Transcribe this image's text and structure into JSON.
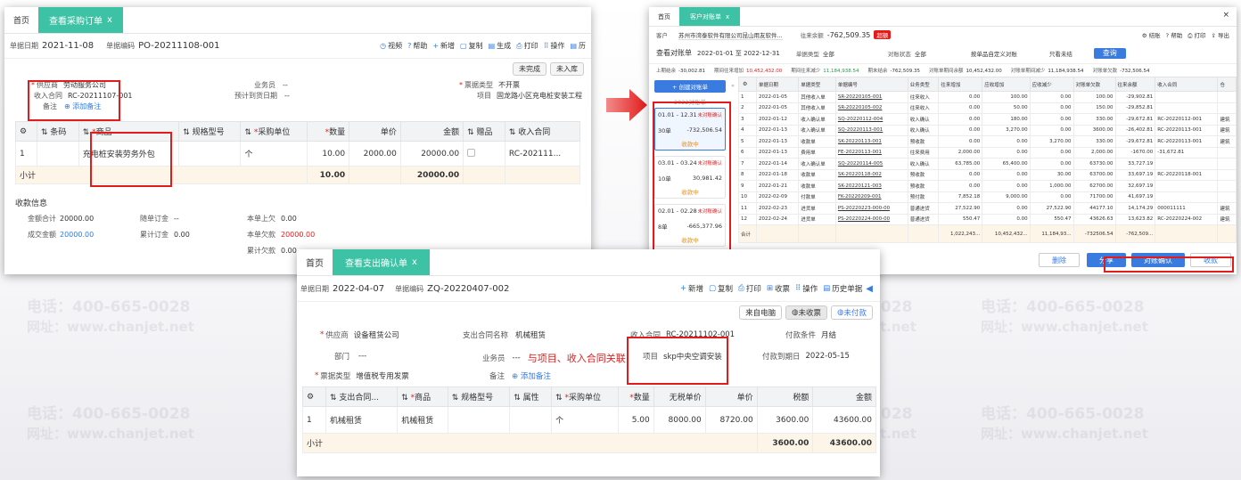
{
  "watermark": {
    "phone": "电话：400-665-0028",
    "site": "网址：www.chanjet.net"
  },
  "win1": {
    "home": "首页",
    "tab": "查看采购订单",
    "close": "x",
    "date_label": "单据日期",
    "date": "2021-11-08",
    "no_label": "单据编码",
    "no": "PO-20211108-001",
    "toolbar": [
      {
        "icon": "◷",
        "label": "视频"
      },
      {
        "icon": "?",
        "label": "帮助"
      },
      {
        "icon": "+",
        "label": "新增"
      },
      {
        "icon": "▢",
        "label": "复制"
      },
      {
        "icon": "▤",
        "label": "生成"
      },
      {
        "icon": "⎙",
        "label": "打印"
      },
      {
        "icon": "⠿",
        "label": "操作"
      },
      {
        "icon": "▤",
        "label": "历"
      }
    ],
    "status": [
      "未完成",
      "未入库"
    ],
    "supplier_label": "供应商",
    "supplier": "劳动服务公司",
    "contract_label": "收入合同",
    "contract": "RC-20211107-001",
    "remark_label": "备注",
    "add_remark": "添加备注",
    "staff_label": "业务员",
    "staff": "--",
    "arrival_label": "预计到货日期",
    "arrival": "--",
    "invoice_label": "票据类型",
    "invoice": "不开票",
    "project_label": "项目",
    "project": "固龙路小区充电桩安装工程",
    "headers": [
      "条码",
      "商品",
      "规格型号",
      "采购单位",
      "数量",
      "单价",
      "金额",
      "赠品",
      "收入合同"
    ],
    "row": {
      "idx": "1",
      "barcode": "",
      "goods": "充电桩安装劳务外包",
      "spec": "",
      "unit": "个",
      "qty": "10.00",
      "price": "2000.00",
      "amount": "20000.00",
      "gift": "",
      "contract": "RC-202111..."
    },
    "subtotal": {
      "label": "小计",
      "qty": "10.00",
      "amount": "20000.00"
    },
    "pay_title": "收款信息",
    "pay": [
      {
        "label": "金额合计",
        "value": "20000.00"
      },
      {
        "label": "随单订金",
        "value": "--"
      },
      {
        "label": "本单上欠",
        "value": "0.00"
      },
      {
        "label": "成交金额",
        "value": "20000.00"
      },
      {
        "label": "累计订金",
        "value": "0.00"
      },
      {
        "label": "本单欠款",
        "value": "20000.00"
      },
      {
        "label": "累计欠款",
        "value": "0.00"
      }
    ]
  },
  "win2": {
    "home": "首页",
    "tab": "客户对账单",
    "close": "x",
    "customer_label": "客户",
    "customer": "苏州市湾泰软件有限公司昆山用友软件...",
    "amt_label": "往来余额",
    "amt": "-762,509.35",
    "amt_badge": "超额",
    "tools": [
      "结账",
      "帮助",
      "打印",
      "导出"
    ],
    "title": "查看对账单",
    "period": "2022-01-01 至 2022-12-31",
    "type_label": "单据类型",
    "type": "全部",
    "state_label": "对账状态",
    "state": "全部",
    "search1": "按单品自定义对账",
    "search2": "只看未结",
    "query": "查询",
    "summary": [
      {
        "label": "上期结余",
        "value": "-30,002.81"
      },
      {
        "label": "期间往来增加",
        "value": "10,452,432.00"
      },
      {
        "label": "期间往来减少",
        "value": "11,184,938.54"
      },
      {
        "label": "期末结余",
        "value": "-762,509.35"
      },
      {
        "label": "对账单期间余额",
        "value": "10,452,432.00"
      },
      {
        "label": "对账单期间减少",
        "value": "11,184,938.54"
      },
      {
        "label": "对账单欠款",
        "value": "-732,506.54"
      }
    ],
    "create": "+ 创建对账单",
    "year": "2022对账单",
    "cards": [
      {
        "range": "01.01 - 12.31",
        "status": "未对账确认",
        "count": "30单",
        "amount": "-732,506.54",
        "tag": "收款中"
      },
      {
        "range": "03.01 - 03.24",
        "status": "未对账确认",
        "count": "10单",
        "amount": "30,981.42",
        "tag": "收款中"
      },
      {
        "range": "02.01 - 02.28",
        "status": "未对账确认",
        "count": "8单",
        "amount": "-665,377.96",
        "tag": "收款中"
      }
    ],
    "headers": [
      "单据日期",
      "单据类型",
      "单据编号",
      "业务类型",
      "往来增加",
      "应收增加",
      "应收减少",
      "对账单欠款",
      "往来余额",
      "收入合同",
      "仓"
    ],
    "rows": [
      [
        "1",
        "2022-01-05",
        "其他收入单",
        "SR-20220105-001",
        "往来收入",
        "0.00",
        "100.00",
        "0.00",
        "100.00",
        "-29,902.81",
        "",
        ""
      ],
      [
        "2",
        "2022-01-05",
        "其他收入单",
        "SR-20220105-002",
        "往来收入",
        "0.00",
        "50.00",
        "0.00",
        "150.00",
        "-29,852.81",
        "",
        ""
      ],
      [
        "3",
        "2022-01-12",
        "收入确认单",
        "SQ-20220112-004",
        "收入确认",
        "0.00",
        "180.00",
        "0.00",
        "330.00",
        "-29,672.81",
        "RC-20220112-001",
        "建筑"
      ],
      [
        "4",
        "2022-01-13",
        "收入确认单",
        "SQ-20220113-001",
        "收入确认",
        "0.00",
        "3,270.00",
        "0.00",
        "3600.00",
        "-26,402.81",
        "RC-20220113-001",
        "建筑"
      ],
      [
        "5",
        "2022-01-13",
        "收款单",
        "SK-20220113-001",
        "预收款",
        "0.00",
        "0.00",
        "3,270.00",
        "330.00",
        "-29,672.81",
        "RC-20220113-001",
        "建筑"
      ],
      [
        "6",
        "2022-01-13",
        "费用单",
        "FE-20220113-001",
        "往来费用",
        "2,000.00",
        "0.00",
        "0.00",
        "2,000.00",
        "-1670.00",
        "-31,672.81",
        ""
      ],
      [
        "7",
        "2022-01-14",
        "收入确认单",
        "SQ-20220114-005",
        "收入确认",
        "63,785.00",
        "65,400.00",
        "0.00",
        "63730.00",
        "33,727.19",
        "",
        ""
      ],
      [
        "8",
        "2022-01-18",
        "收款单",
        "SK-20220118-002",
        "预收款",
        "0.00",
        "0.00",
        "30.00",
        "63700.00",
        "33,697.19",
        "RC-20220118-001",
        ""
      ],
      [
        "9",
        "2022-01-21",
        "收款单",
        "SK-20220121-003",
        "预收款",
        "0.00",
        "0.00",
        "1,000.00",
        "62700.00",
        "32,697.19",
        "",
        ""
      ],
      [
        "10",
        "2022-02-09",
        "付款单",
        "FK-20220209-001",
        "预付款",
        "7,852.18",
        "9,000.00",
        "0.00",
        "71700.00",
        "41,697.19",
        "",
        ""
      ],
      [
        "11",
        "2022-02-23",
        "进货单",
        "PS-20220223-000-00",
        "普通进货",
        "27,522.90",
        "0.00",
        "27,522.90",
        "44177.10",
        "14,174.29",
        "000011111",
        "建筑"
      ],
      [
        "12",
        "2022-02-24",
        "进货单",
        "PS-20220224-000-00",
        "普通进货",
        "550.47",
        "0.00",
        "550.47",
        "43626.63",
        "13,623.82",
        "RC-20220224-002",
        "建筑"
      ]
    ],
    "total": {
      "label": "合计",
      "a": "1,022,243...",
      "b": "10,452,432...",
      "c": "11,184,93...",
      "d": "-732506.54",
      "e": "-762,509..."
    },
    "delete": "删除",
    "share": "分享",
    "confirm": "对账确认",
    "collect": "收款"
  },
  "win3": {
    "home": "首页",
    "tab": "查看支出确认单",
    "close": "x",
    "date_label": "单据日期",
    "date": "2022-04-07",
    "no_label": "单据编码",
    "no": "ZQ-20220407-002",
    "toolbar": [
      {
        "icon": "+",
        "label": "新增"
      },
      {
        "icon": "▢",
        "label": "复制"
      },
      {
        "icon": "⎙",
        "label": "打印"
      },
      {
        "icon": "⊞",
        "label": "收票"
      },
      {
        "icon": "⠿",
        "label": "操作"
      },
      {
        "icon": "▤",
        "label": "历史单据"
      }
    ],
    "status": [
      "来自电脑",
      "未收票",
      "未付款"
    ],
    "supplier_label": "供应商",
    "supplier": "设备租赁公司",
    "pcontract_label": "支出合同名称",
    "pcontract": "机械租赁",
    "contract_label": "收入合同",
    "contract": "RC-20211102-001",
    "terms_label": "付款条件",
    "terms": "月结",
    "dept_label": "部门",
    "dept": "---",
    "staff_label": "业务员",
    "staff": "---",
    "note": "与项目、收入合同关联",
    "project_label": "项目",
    "project": "skp中央空调安装",
    "due_label": "付款到期日",
    "due": "2022-05-15",
    "invoice_label": "票据类型",
    "invoice": "增值税专用发票",
    "remark_label": "备注",
    "add_remark": "添加备注",
    "headers": [
      "支出合同...",
      "商品",
      "规格型号",
      "属性",
      "采购单位",
      "数量",
      "无税单价",
      "单价",
      "税额",
      "金额"
    ],
    "row": {
      "idx": "1",
      "pc": "机械租赁",
      "goods": "机械租赁",
      "spec": "",
      "attr": "",
      "unit": "个",
      "qty": "5.00",
      "nprice": "8000.00",
      "price": "8720.00",
      "tax": "3600.00",
      "amount": "43600.00"
    },
    "subtotal": {
      "label": "小计",
      "tax": "3600.00",
      "amount": "43600.00"
    }
  },
  "colors": {
    "accent": "#3ec2a5",
    "red": "#e21b1b",
    "blue": "#3a7be0"
  }
}
